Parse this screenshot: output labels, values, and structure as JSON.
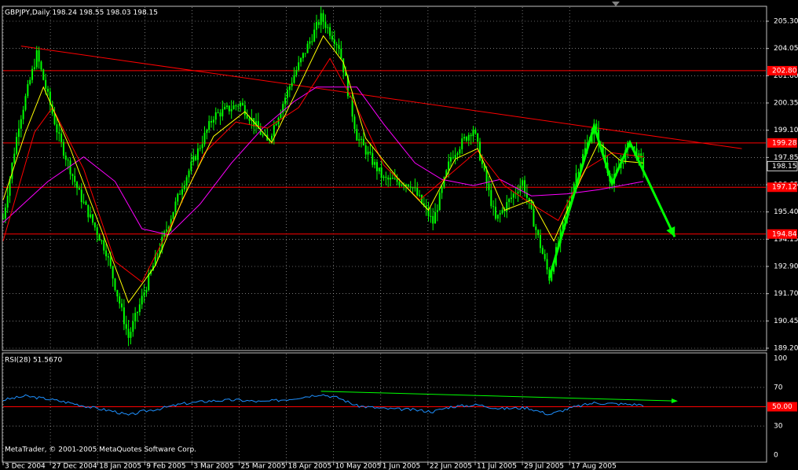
{
  "window": {
    "title": "GBPJPY,Daily  198.24 198.55 198.03 198.15"
  },
  "colors": {
    "background": "#000000",
    "frame": "#c0c0c0",
    "grid": "#c0c0c0",
    "candle": "#00ff00",
    "level_line": "#ff0000",
    "trend_line": "#ff0000",
    "ma_fast": "#ffff00",
    "ma_mid": "#ff0000",
    "ma_slow": "#ff00ff",
    "rsi": "#1e90ff",
    "rsi_trend": "#00ff00",
    "arrow": "#00ff00",
    "price_tag_bg": "#ff0000",
    "current_tag_bg": "#000000"
  },
  "chart_data": [
    {
      "type": "line",
      "title": "GBPJPY,Daily  198.24 198.55 198.03 198.15",
      "y_ticks": [
        "205.30",
        "204.05",
        "201.60",
        "200.35",
        "199.10",
        "197.85",
        "196.65",
        "195.40",
        "194.15",
        "192.90",
        "191.70",
        "190.45",
        "189.20"
      ],
      "ylim": [
        189.2,
        205.9
      ],
      "x_ticks": [
        "3 Dec 2004",
        "27 Dec 2004",
        "18 Jan 2005",
        "9 Feb 2005",
        "3 Mar 2005",
        "25 Mar 2005",
        "18 Apr 2005",
        "10 May 2005",
        "1 Jun 2005",
        "22 Jun 2005",
        "11 Jul 2005",
        "29 Jul 2005",
        "17 Aug 2005"
      ],
      "price_levels": [
        {
          "label": "202.80",
          "value": 202.8
        },
        {
          "label": "199.28",
          "value": 199.28
        },
        {
          "label": "197.12",
          "value": 197.12
        },
        {
          "label": "194.84",
          "value": 194.84
        }
      ],
      "current_price": {
        "label": "198.15",
        "value": 198.15
      },
      "price_path": [
        [
          0,
          195.6
        ],
        [
          7,
          200.2
        ],
        [
          15,
          203.6
        ],
        [
          25,
          199.5
        ],
        [
          34,
          196.8
        ],
        [
          46,
          194.0
        ],
        [
          56,
          189.8
        ],
        [
          68,
          193.6
        ],
        [
          80,
          197.2
        ],
        [
          94,
          200.6
        ],
        [
          106,
          201.2
        ],
        [
          118,
          199.3
        ],
        [
          130,
          202.6
        ],
        [
          142,
          205.4
        ],
        [
          150,
          204.0
        ],
        [
          158,
          199.6
        ],
        [
          170,
          197.5
        ],
        [
          182,
          197.3
        ],
        [
          192,
          195.4
        ],
        [
          200,
          198.6
        ],
        [
          210,
          200.0
        ],
        [
          220,
          195.5
        ],
        [
          232,
          197.4
        ],
        [
          244,
          192.7
        ],
        [
          256,
          197.8
        ],
        [
          264,
          200.1
        ],
        [
          272,
          197.3
        ],
        [
          280,
          199.3
        ],
        [
          286,
          198.15
        ]
      ],
      "ma_fast": [
        [
          0,
          196.5
        ],
        [
          10,
          199.8
        ],
        [
          18,
          202.0
        ],
        [
          30,
          199.0
        ],
        [
          44,
          195.0
        ],
        [
          56,
          191.5
        ],
        [
          68,
          193.3
        ],
        [
          80,
          196.5
        ],
        [
          94,
          199.6
        ],
        [
          108,
          200.8
        ],
        [
          120,
          199.3
        ],
        [
          132,
          202.0
        ],
        [
          143,
          204.5
        ],
        [
          152,
          203.2
        ],
        [
          162,
          199.5
        ],
        [
          176,
          197.6
        ],
        [
          190,
          196.0
        ],
        [
          202,
          198.5
        ],
        [
          212,
          199.0
        ],
        [
          224,
          196.0
        ],
        [
          236,
          196.5
        ],
        [
          246,
          194.5
        ],
        [
          258,
          197.5
        ],
        [
          266,
          199.3
        ],
        [
          276,
          198.4
        ],
        [
          286,
          198.3
        ]
      ],
      "ma_mid": [
        [
          0,
          194.5
        ],
        [
          14,
          199.8
        ],
        [
          22,
          201.0
        ],
        [
          36,
          198.0
        ],
        [
          50,
          193.5
        ],
        [
          62,
          192.5
        ],
        [
          76,
          195.5
        ],
        [
          90,
          198.8
        ],
        [
          104,
          200.3
        ],
        [
          118,
          200.0
        ],
        [
          132,
          201.0
        ],
        [
          146,
          203.4
        ],
        [
          158,
          201.0
        ],
        [
          170,
          198.2
        ],
        [
          186,
          196.5
        ],
        [
          198,
          197.6
        ],
        [
          212,
          198.9
        ],
        [
          224,
          197.2
        ],
        [
          236,
          196.3
        ],
        [
          248,
          195.5
        ],
        [
          260,
          198.0
        ],
        [
          272,
          198.8
        ],
        [
          286,
          198.6
        ]
      ],
      "ma_slow": [
        [
          0,
          195.4
        ],
        [
          20,
          197.4
        ],
        [
          36,
          198.6
        ],
        [
          50,
          197.4
        ],
        [
          62,
          195.1
        ],
        [
          74,
          194.8
        ],
        [
          88,
          196.3
        ],
        [
          102,
          198.3
        ],
        [
          116,
          200.0
        ],
        [
          130,
          201.3
        ],
        [
          140,
          202.0
        ],
        [
          158,
          202.0
        ],
        [
          170,
          200.2
        ],
        [
          184,
          198.3
        ],
        [
          196,
          197.5
        ],
        [
          210,
          197.2
        ],
        [
          222,
          197.5
        ],
        [
          236,
          196.7
        ],
        [
          252,
          196.8
        ],
        [
          266,
          197.0
        ],
        [
          286,
          197.4
        ]
      ],
      "trend_line": [
        [
          8,
          204.0
        ],
        [
          330,
          199.0
        ]
      ],
      "forecast_arrows": [
        [
          [
            244,
            192.7
          ],
          [
            264,
            200.1
          ],
          [
            272,
            197.3
          ],
          [
            280,
            199.3
          ],
          [
            300,
            194.7
          ]
        ]
      ]
    },
    {
      "type": "line",
      "title": "RSI(28) 51.5670",
      "ylim": [
        0,
        100
      ],
      "y_ticks": [
        "100",
        "70",
        "50",
        "30",
        "0"
      ],
      "level": {
        "label": "50.00",
        "value": 50
      },
      "trend_line": [
        [
          142,
          66
        ],
        [
          300,
          56
        ]
      ],
      "values": [
        [
          0,
          57
        ],
        [
          10,
          61
        ],
        [
          20,
          58
        ],
        [
          30,
          54
        ],
        [
          40,
          49
        ],
        [
          50,
          45
        ],
        [
          56,
          41
        ],
        [
          62,
          45
        ],
        [
          70,
          48
        ],
        [
          80,
          53
        ],
        [
          92,
          56
        ],
        [
          104,
          57
        ],
        [
          116,
          55
        ],
        [
          128,
          58
        ],
        [
          142,
          63
        ],
        [
          150,
          59
        ],
        [
          158,
          51
        ],
        [
          170,
          48
        ],
        [
          182,
          47
        ],
        [
          192,
          45
        ],
        [
          200,
          50
        ],
        [
          212,
          52
        ],
        [
          222,
          48
        ],
        [
          234,
          49
        ],
        [
          244,
          42
        ],
        [
          254,
          49
        ],
        [
          264,
          54
        ],
        [
          274,
          53
        ],
        [
          286,
          52
        ]
      ]
    }
  ],
  "copyright": "MetaTrader, © 2001-2005 MetaQuotes Software Corp."
}
